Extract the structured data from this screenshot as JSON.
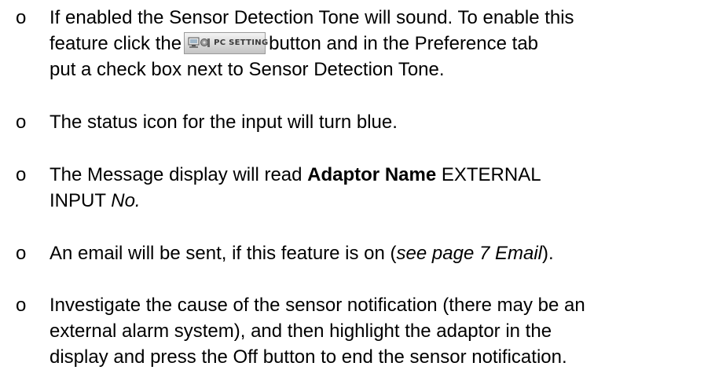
{
  "bullet_char": "o",
  "items": [
    {
      "line1_pre": "If enabled the Sensor Detection Tone will sound. To enable this",
      "line2_pre": "feature click the",
      "button_label": "PC SETTING",
      "line2_post": "button and in the Preference tab",
      "line3": "put a check box next to Sensor Detection Tone."
    },
    {
      "line1": "The status icon for the input will turn blue."
    },
    {
      "line1_pre": "The Message display will read",
      "bold": "Adaptor Name",
      "line1_post": "EXTERNAL",
      "line2_pre": "INPUT",
      "italic": "No."
    },
    {
      "line1_pre": "An email will be sent, if this feature is on (",
      "italic": "see page 7 Email",
      "line1_post": ")."
    },
    {
      "line1": "Investigate the cause of the sensor notification (there may be an",
      "line2": "external alarm system), and then highlight the adaptor in the",
      "line3": "display and press the Off button to end the sensor notification."
    }
  ]
}
